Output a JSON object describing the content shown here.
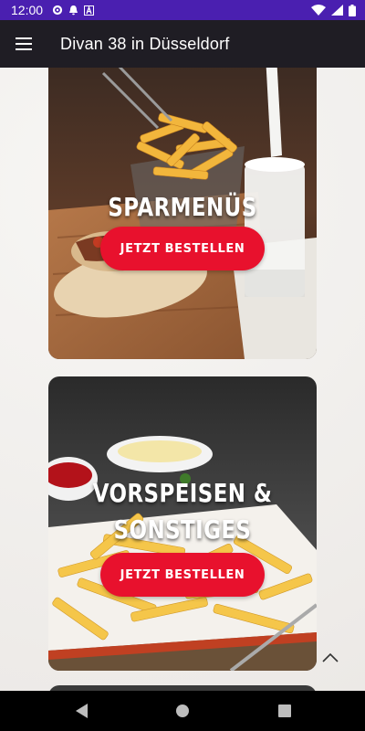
{
  "status_bar": {
    "time": "12:00",
    "icons_left": [
      "settings-icon",
      "notification-icon",
      "a-icon"
    ],
    "icons_right": [
      "wifi-icon",
      "signal-icon",
      "battery-icon"
    ]
  },
  "app_bar": {
    "menu_icon": "hamburger-menu-icon",
    "title": "Divan 38 in Düsseldorf"
  },
  "cards": [
    {
      "title": "SPARMENÜS",
      "button_label": "JETZT BESTELLEN"
    },
    {
      "title": "VORSPEISEN & SONSTIGES",
      "button_label": "JETZT BESTELLEN"
    }
  ],
  "scroll_top_icon": "chevron-up-icon",
  "nav_bar": {
    "icons": [
      "back-icon",
      "home-icon",
      "recents-icon"
    ]
  },
  "colors": {
    "status_bar": "#4a1fb0",
    "app_bar": "#1f1d24",
    "button": "#e8112d",
    "nav_bar": "#000000"
  }
}
